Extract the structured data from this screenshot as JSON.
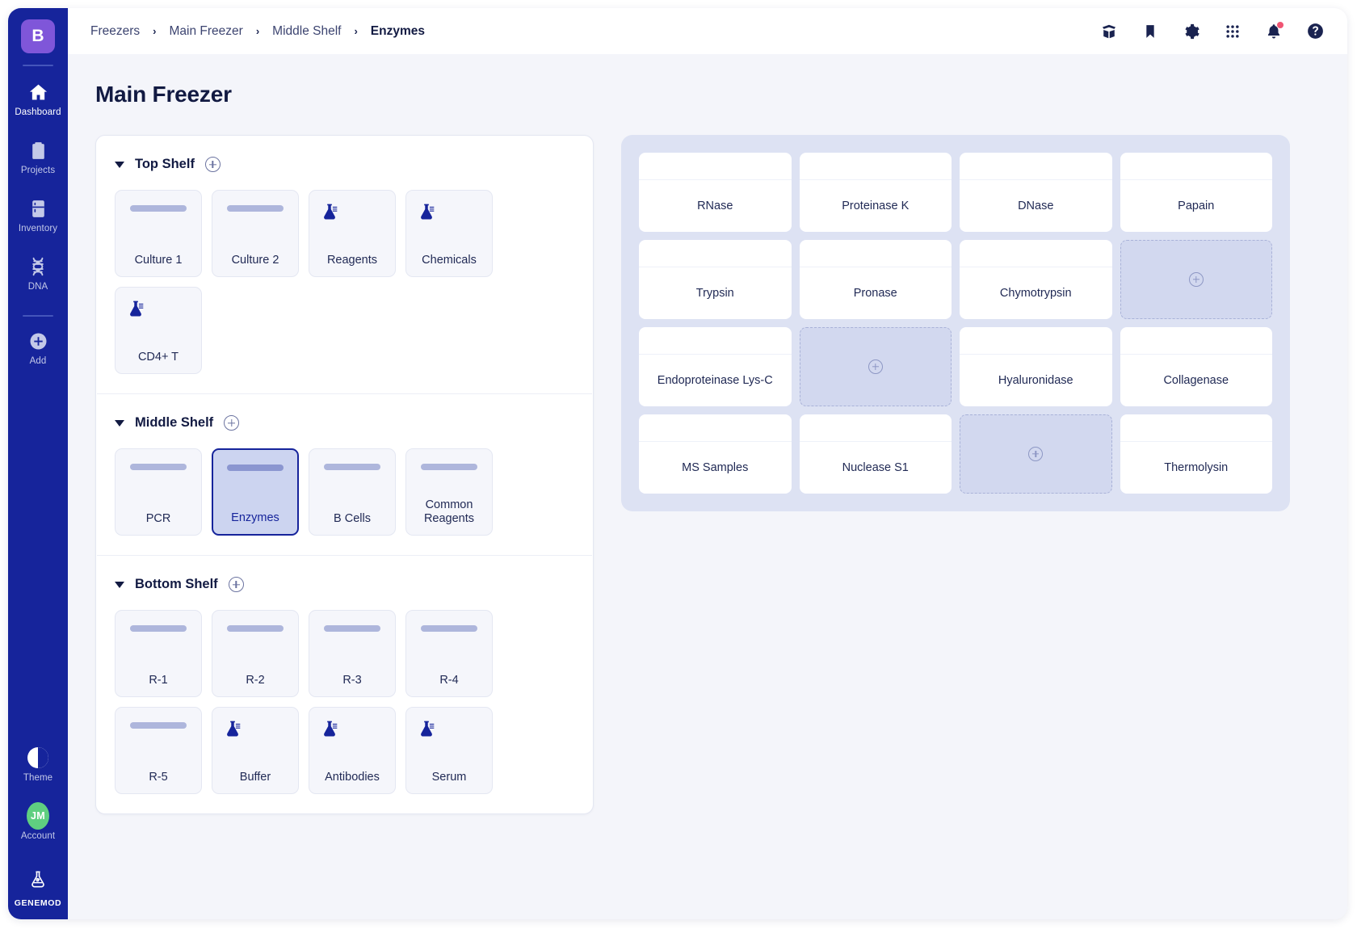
{
  "sidebar": {
    "brand_initial": "B",
    "items": [
      {
        "label": "Dashboard",
        "icon": "home-icon",
        "active": true
      },
      {
        "label": "Projects",
        "icon": "clipboard-icon",
        "active": false
      },
      {
        "label": "Inventory",
        "icon": "fridge-icon",
        "active": false
      },
      {
        "label": "DNA",
        "icon": "dna-icon",
        "active": false
      },
      {
        "label": "Add",
        "icon": "plus-circle-icon",
        "active": false
      }
    ],
    "theme_label": "Theme",
    "account_label": "Account",
    "account_initials": "JM",
    "logo_label": "GENEMOD"
  },
  "topbar": {
    "breadcrumbs": [
      {
        "label": "Freezers",
        "current": false
      },
      {
        "label": "Main Freezer",
        "current": false
      },
      {
        "label": "Middle Shelf",
        "current": false
      },
      {
        "label": "Enzymes",
        "current": true
      }
    ],
    "separator": "›",
    "actions": [
      {
        "name": "open-box-icon"
      },
      {
        "name": "bookmark-icon"
      },
      {
        "name": "gear-icon"
      },
      {
        "name": "apps-grid-icon"
      },
      {
        "name": "bell-icon",
        "badge": true
      },
      {
        "name": "help-icon"
      }
    ]
  },
  "page": {
    "title": "Main Freezer"
  },
  "shelves": [
    {
      "name": "Top Shelf",
      "boxes": [
        {
          "label": "Culture 1",
          "marker": "bar"
        },
        {
          "label": "Culture 2",
          "marker": "bar"
        },
        {
          "label": "Reagents",
          "marker": "flask"
        },
        {
          "label": "Chemicals",
          "marker": "flask"
        },
        {
          "label": "CD4+ T",
          "marker": "flask"
        }
      ]
    },
    {
      "name": "Middle Shelf",
      "boxes": [
        {
          "label": "PCR",
          "marker": "bar"
        },
        {
          "label": "Enzymes",
          "marker": "bar",
          "selected": true
        },
        {
          "label": "B Cells",
          "marker": "bar"
        },
        {
          "label": "Common Reagents",
          "marker": "bar"
        }
      ]
    },
    {
      "name": "Bottom Shelf",
      "boxes": [
        {
          "label": "R-1",
          "marker": "bar"
        },
        {
          "label": "R-2",
          "marker": "bar"
        },
        {
          "label": "R-3",
          "marker": "bar"
        },
        {
          "label": "R-4",
          "marker": "bar"
        },
        {
          "label": "R-5",
          "marker": "bar"
        },
        {
          "label": "Buffer",
          "marker": "flask"
        },
        {
          "label": "Antibodies",
          "marker": "flask"
        },
        {
          "label": "Serum",
          "marker": "flask"
        }
      ]
    }
  ],
  "grid": {
    "columns": 4,
    "cells": [
      {
        "label": "RNase",
        "empty": false
      },
      {
        "label": "Proteinase K",
        "empty": false
      },
      {
        "label": "DNase",
        "empty": false
      },
      {
        "label": "Papain",
        "empty": false
      },
      {
        "label": "Trypsin",
        "empty": false
      },
      {
        "label": "Pronase",
        "empty": false
      },
      {
        "label": "Chymotrypsin",
        "empty": false
      },
      {
        "label": "",
        "empty": true
      },
      {
        "label": "Endoproteinase Lys-C",
        "empty": false
      },
      {
        "label": "",
        "empty": true
      },
      {
        "label": "Hyaluronidase",
        "empty": false
      },
      {
        "label": "Collagenase",
        "empty": false
      },
      {
        "label": "MS Samples",
        "empty": false
      },
      {
        "label": "Nuclease S1",
        "empty": false
      },
      {
        "label": "",
        "empty": true
      },
      {
        "label": "Thermolysin",
        "empty": false
      }
    ]
  },
  "colors": {
    "sidebar": "#16249b",
    "brand_tile": "#7f56d9",
    "accent": "#16249b",
    "avatar": "#5fcf80",
    "notification": "#f05573",
    "grid_panel_bg": "#dde2f3",
    "selected_box_bg": "#ccd4f0",
    "page_bg": "#f4f5fa",
    "text_dark": "#121a42"
  }
}
